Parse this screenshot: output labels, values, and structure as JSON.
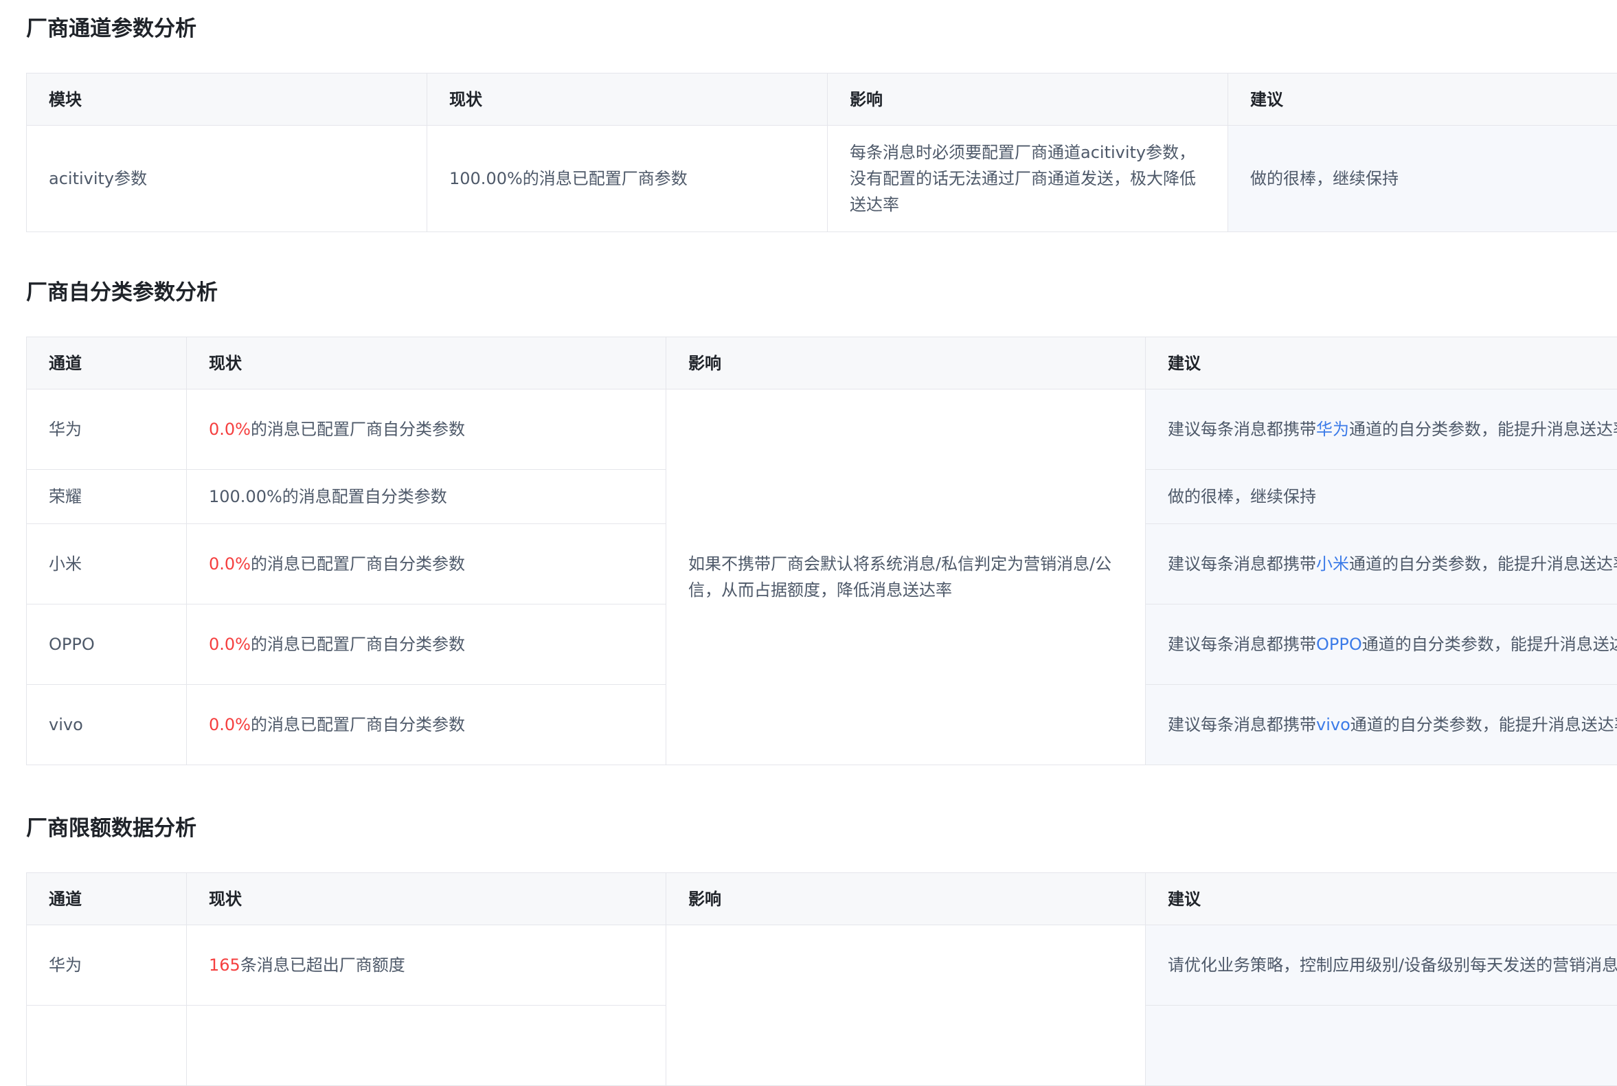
{
  "sections": [
    {
      "title": "厂商通道参数分析",
      "headers": [
        "模块",
        "现状",
        "影响",
        "建议"
      ],
      "rows": [
        {
          "module": "acitivity参数",
          "status": "100.00%的消息已配置厂商参数",
          "impact": "每条消息时必须要配置厂商通道acitivity参数，没有配置的话无法通过厂商通道发送，极大降低送达率",
          "advice": "做的很棒，继续保持"
        }
      ]
    },
    {
      "title": "厂商自分类参数分析",
      "headers": [
        "通道",
        "现状",
        "影响",
        "建议"
      ],
      "impact_shared": "如果不携带厂商会默认将系统消息/私信判定为营销消息/公信，从而占据额度，降低消息送达率",
      "rows": [
        {
          "channel": "华为",
          "status_value": "0.0%",
          "status_text": "的消息已配置厂商自分类参数",
          "advice_prefix": "建议每条消息都携带",
          "advice_channel": "华为",
          "advice_suffix": "通道的自分类参数，能提升消息送达率"
        },
        {
          "channel": "荣耀",
          "status_value": "",
          "status_text": "100.00%的消息配置自分类参数",
          "advice_prefix": "做的很棒，继续保持",
          "advice_channel": "",
          "advice_suffix": ""
        },
        {
          "channel": "小米",
          "status_value": "0.0%",
          "status_text": "的消息已配置厂商自分类参数",
          "advice_prefix": "建议每条消息都携带",
          "advice_channel": "小米",
          "advice_suffix": "通道的自分类参数，能提升消息送达率"
        },
        {
          "channel": "OPPO",
          "status_value": "0.0%",
          "status_text": "的消息已配置厂商自分类参数",
          "advice_prefix": "建议每条消息都携带",
          "advice_channel": "OPPO",
          "advice_suffix": "通道的自分类参数，能提升消息送达率"
        },
        {
          "channel": "vivo",
          "status_value": "0.0%",
          "status_text": "的消息已配置厂商自分类参数",
          "advice_prefix": "建议每条消息都携带",
          "advice_channel": "vivo",
          "advice_suffix": "通道的自分类参数，能提升消息送达率"
        }
      ]
    },
    {
      "title": "厂商限额数据分析",
      "headers": [
        "通道",
        "现状",
        "影响",
        "建议"
      ],
      "rows": [
        {
          "channel": "华为",
          "status_value": "165",
          "status_text": "条消息已超出厂商额度",
          "advice": "请优化业务策略，控制应用级别/设备级别每天发送的营销消息条数"
        }
      ]
    }
  ],
  "colors": {
    "highlight_red": "#f53f3f",
    "highlight_blue": "#3c7be8",
    "header_bg": "#f7f8fa",
    "advice_bg": "#f6f8fc",
    "border": "#e5e6eb"
  }
}
